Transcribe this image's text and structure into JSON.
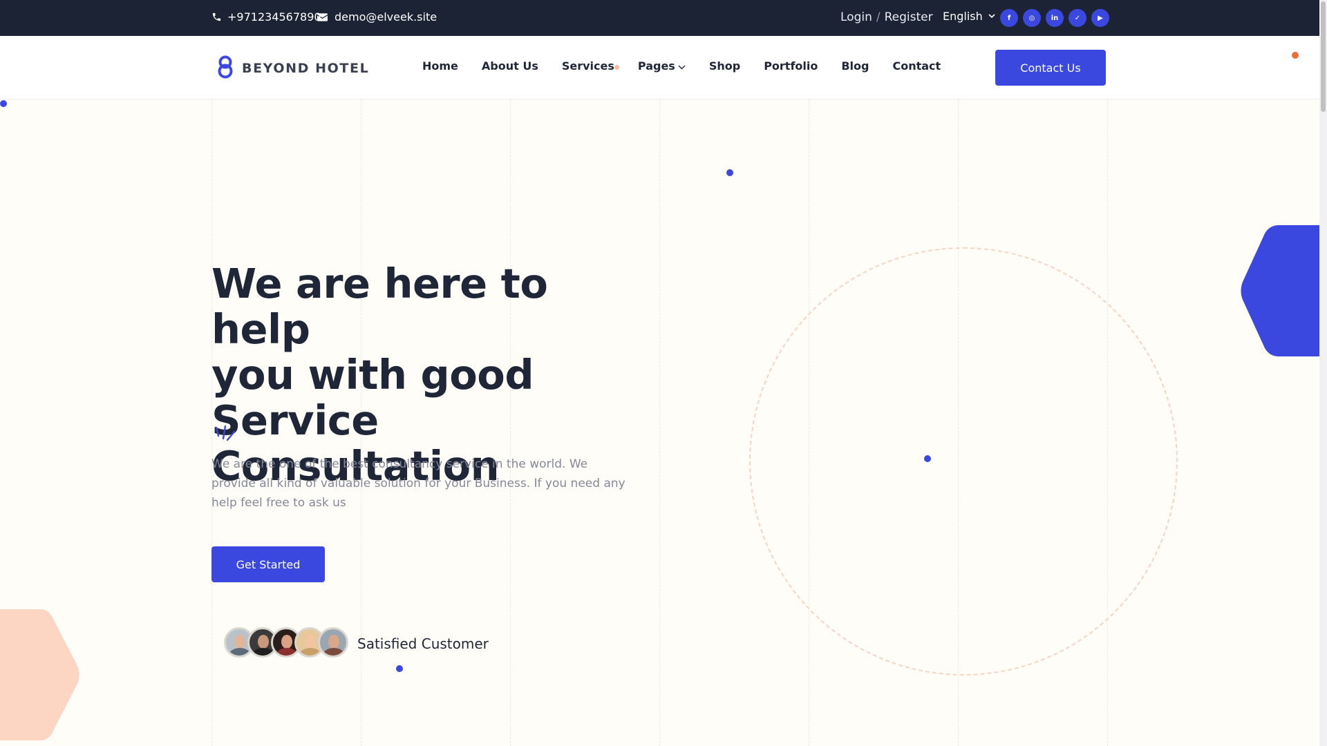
{
  "topbar": {
    "phone": "+971234567890",
    "email": "demo@elveek.site",
    "login": "Login",
    "separator": "/",
    "register": "Register",
    "language": "English",
    "socials": [
      {
        "icon": "facebook-icon",
        "glyph": "f"
      },
      {
        "icon": "instagram-icon",
        "glyph": "◎"
      },
      {
        "icon": "linkedin-icon",
        "glyph": "in"
      },
      {
        "icon": "twitter-icon",
        "glyph": "✓"
      },
      {
        "icon": "youtube-icon",
        "glyph": "▶"
      }
    ]
  },
  "header": {
    "logo_text": "BEYOND HOTEL",
    "nav": [
      "Home",
      "About Us",
      "Services",
      "Pages",
      "Shop",
      "Portfolio",
      "Blog",
      "Contact"
    ],
    "cta_label": "Contact Us"
  },
  "hero": {
    "title_line1": "We are here to help",
    "title_line2": "you with good",
    "title_line3": "Service Consultation",
    "description": "We are the one of the best consultancy service in the world. We provide all kind of valuable solution for your Business. If you need any help feel free to ask us",
    "cta_label": "Get Started",
    "satisfied_label": "Satisfied Customer"
  },
  "colors": {
    "brand_blue": "#3a48df",
    "dark_navy": "#1c2334",
    "accent_orange": "#f06a3a",
    "peach": "#fdd5c3",
    "page_bg": "#fffdf8"
  }
}
